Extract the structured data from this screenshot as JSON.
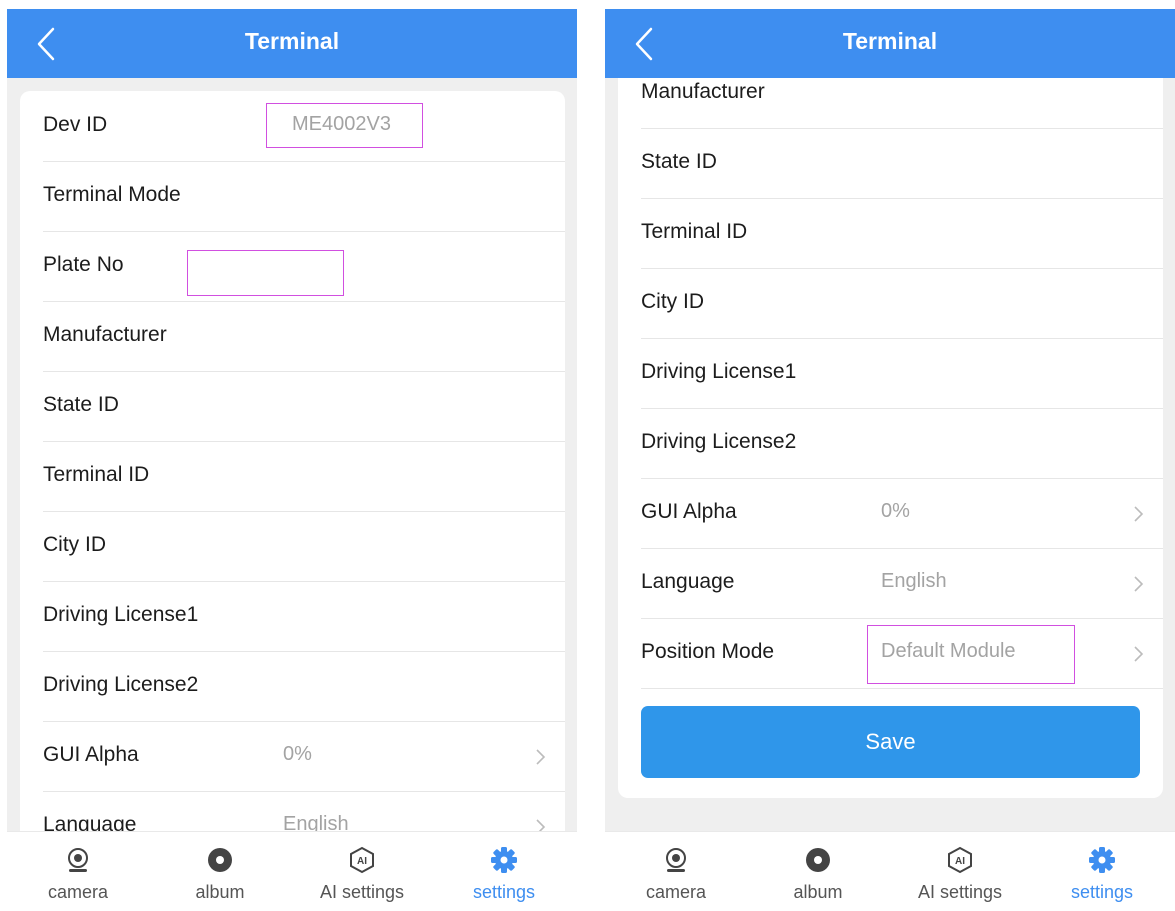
{
  "screens": [
    {
      "title": "Terminal",
      "rows": [
        {
          "label": "Dev ID",
          "value": "ME4002V3"
        },
        {
          "label": "Terminal Mode"
        },
        {
          "label": "Plate No",
          "value": ""
        },
        {
          "label": "Manufacturer"
        },
        {
          "label": "State ID"
        },
        {
          "label": "Terminal ID"
        },
        {
          "label": "City ID"
        },
        {
          "label": "Driving License1"
        },
        {
          "label": "Driving License2"
        },
        {
          "label": "GUI Alpha",
          "value": "0%"
        },
        {
          "label": "Language",
          "value": "English"
        }
      ]
    },
    {
      "title": "Terminal",
      "rows": [
        {
          "label": "Manufacturer"
        },
        {
          "label": "State ID"
        },
        {
          "label": "Terminal ID"
        },
        {
          "label": "City ID"
        },
        {
          "label": "Driving License1"
        },
        {
          "label": "Driving License2"
        },
        {
          "label": "GUI Alpha",
          "value": "0%"
        },
        {
          "label": "Language",
          "value": "English"
        },
        {
          "label": "Position Mode",
          "value": "Default Module"
        }
      ],
      "save_label": "Save"
    }
  ],
  "tabbar": {
    "tabs": [
      {
        "label": "camera",
        "icon": "camera-icon"
      },
      {
        "label": "album",
        "icon": "album-icon"
      },
      {
        "label": "AI settings",
        "icon": "ai-icon"
      },
      {
        "label": "settings",
        "icon": "gear-icon",
        "active": true
      }
    ]
  },
  "colors": {
    "header": "#3e8ef0",
    "save_button": "#2f96ea",
    "active_tab": "#3e8ef0",
    "highlight_box": "#d14fe0"
  }
}
